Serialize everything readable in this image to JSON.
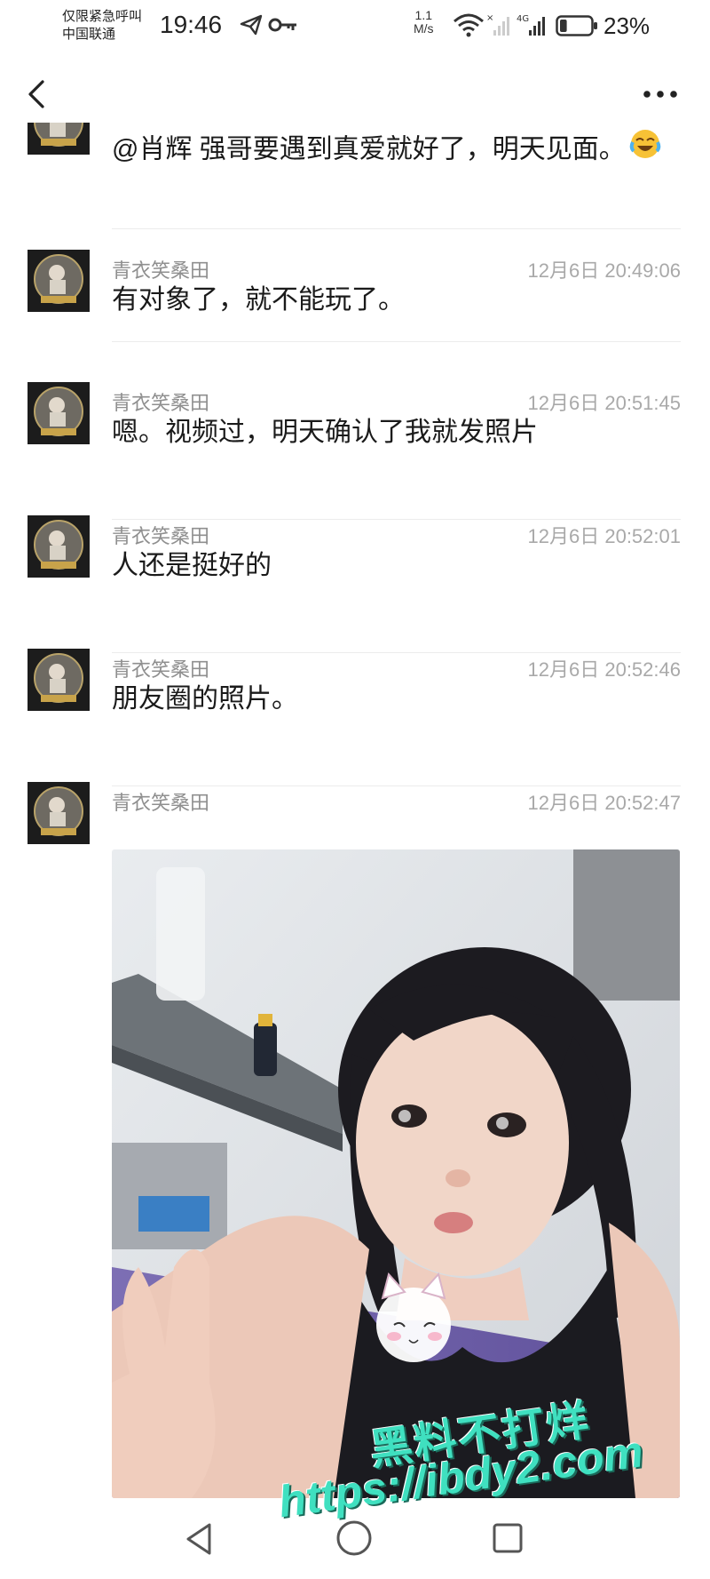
{
  "status_bar": {
    "carrier_line1": "仅限紧急呼叫",
    "carrier_line2": "中国联通",
    "time": "19:46",
    "net_speed_value": "1.1",
    "net_speed_unit": "M/s",
    "network_type": "4G",
    "battery_percent": "23%",
    "battery_level": 0.23
  },
  "header": {
    "back_icon": "chevron-left-icon",
    "more_icon": "more-horizontal-icon"
  },
  "messages": [
    {
      "sender": "",
      "time": "",
      "text": "@肖辉 强哥要遇到真爱就好了，明天见面。",
      "emoji": "laughing-tears-emoji"
    },
    {
      "sender": "青衣笑桑田",
      "time": "12月6日 20:49:06",
      "text": "有对象了，就不能玩了。"
    },
    {
      "sender": "青衣笑桑田",
      "time": "12月6日 20:51:45",
      "text": "嗯。视频过，明天确认了我就发照片"
    },
    {
      "sender": "青衣笑桑田",
      "time": "12月6日 20:52:01",
      "text": "人还是挺好的"
    },
    {
      "sender": "青衣笑桑田",
      "time": "12月6日 20:52:46",
      "text": "朋友圈的照片。"
    },
    {
      "sender": "青衣笑桑田",
      "time": "12月6日 20:52:47",
      "text": ""
    }
  ],
  "watermark": {
    "line1": "黑料不打烊",
    "line2": "https://ibdy2.com"
  },
  "nav": {
    "back_icon": "triangle-back-icon",
    "home_icon": "circle-home-icon",
    "recent_icon": "square-recent-icon"
  }
}
